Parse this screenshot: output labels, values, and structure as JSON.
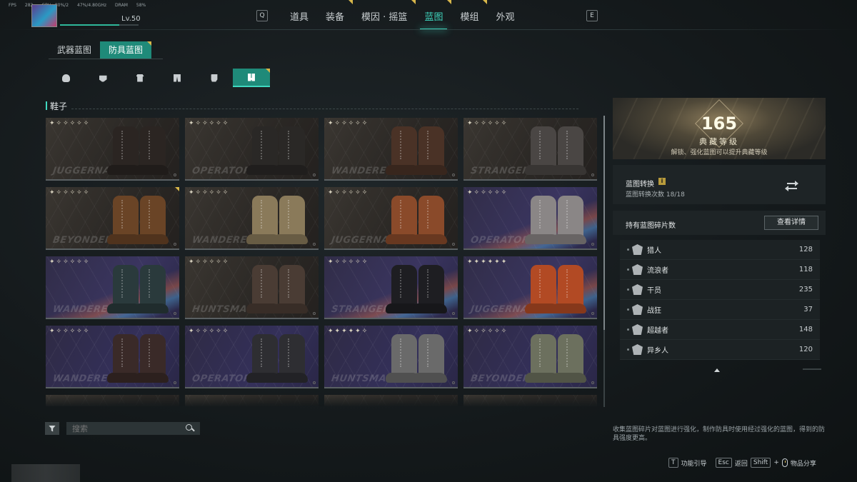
{
  "hud": {
    "fps_label": "FPS",
    "fps_value": "282",
    "gpu": "GPU : 80%/2",
    "cpu": "47%/4.80GHz",
    "dram_label": "DRAM",
    "dram_value": "58%"
  },
  "player": {
    "level": "Lv.50",
    "xp_fraction": 0.75
  },
  "top_nav": {
    "left_key": "Q",
    "right_key": "E",
    "tabs": [
      {
        "label": "道具",
        "badge": false
      },
      {
        "label": "装备",
        "badge": true
      },
      {
        "label": "模因 · 摇篮",
        "badge": true
      },
      {
        "label": "蓝图",
        "badge": true,
        "active": true
      },
      {
        "label": "模组",
        "badge": true
      },
      {
        "label": "外观",
        "badge": false
      }
    ]
  },
  "blueprint_tabs": [
    {
      "label": "武器蓝图",
      "active": false
    },
    {
      "label": "防具蓝图",
      "active": true,
      "badge": true
    }
  ],
  "armor_slots": [
    {
      "icon": "helmet-icon"
    },
    {
      "icon": "mask-icon"
    },
    {
      "icon": "top-icon"
    },
    {
      "icon": "pants-icon"
    },
    {
      "icon": "gloves-icon"
    },
    {
      "icon": "boots-icon",
      "active": true,
      "badge": true
    }
  ],
  "section_title": "鞋子",
  "items": [
    {
      "brand": "JUGGERNAUT",
      "stars": "✦✧✧✧✧✧",
      "quality": "common",
      "color": "#2b2522"
    },
    {
      "brand": "OPERATOR",
      "stars": "✦✧✧✧✧✧",
      "quality": "common",
      "color": "#2a2826"
    },
    {
      "brand": "WANDERER",
      "stars": "✦✧✧✧✧✧",
      "quality": "common",
      "color": "#4a3226"
    },
    {
      "brand": "STRANGER",
      "stars": "✦✧✧✧✧✧",
      "quality": "common",
      "color": "#4a4644"
    },
    {
      "brand": "BEYONDER",
      "stars": "✦✧✧✧✧✧",
      "quality": "common",
      "color": "#6a4426",
      "badge": true
    },
    {
      "brand": "WANDERER",
      "stars": "✦✧✧✧✧✧",
      "quality": "common",
      "color": "#8a7a5a"
    },
    {
      "brand": "JUGGERNAUT",
      "stars": "✦✧✧✧✧✧",
      "quality": "common",
      "color": "#8a4a2a"
    },
    {
      "brand": "OPERATOR",
      "stars": "✦✧✧✧✧✧",
      "quality": "rainbow",
      "color": "#8a8686"
    },
    {
      "brand": "WANDERER",
      "stars": "✦✧✧✧✧✧",
      "quality": "rainbow",
      "color": "#2a3a3c"
    },
    {
      "brand": "HUNTSMAN",
      "stars": "✦✧✧✧✧✧",
      "quality": "common",
      "color": "#4a3c34"
    },
    {
      "brand": "STRANGER",
      "stars": "✦✧✧✧✧✧",
      "quality": "rainbow",
      "color": "#1e1e22"
    },
    {
      "brand": "JUGGERNAUT",
      "stars": "✦✦✦✦✦✦",
      "quality": "rainbow",
      "color": "#b24a24"
    },
    {
      "brand": "WANDERER",
      "stars": "✦✧✧✧✧✧",
      "quality": "purple",
      "color": "#3a2a28"
    },
    {
      "brand": "OPERATOR",
      "stars": "✦✧✧✧✧✧",
      "quality": "purple",
      "color": "#2e2e32"
    },
    {
      "brand": "HUNTSMAN",
      "stars": "✦✦✦✦✦✧",
      "quality": "purple",
      "color": "#6a6a6a"
    },
    {
      "brand": "BEYONDER",
      "stars": "✦✧✧✧✧✧",
      "quality": "purple",
      "color": "#6c705e"
    },
    {
      "brand": "",
      "stars": "",
      "quality": "common",
      "color": "#2a2826"
    },
    {
      "brand": "",
      "stars": "",
      "quality": "common",
      "color": "#2a2826"
    },
    {
      "brand": "",
      "stars": "",
      "quality": "common",
      "color": "#2a2826"
    },
    {
      "brand": "",
      "stars": "",
      "quality": "common",
      "color": "#2a2826"
    }
  ],
  "search": {
    "placeholder": "搜索"
  },
  "collection": {
    "level": "165",
    "label": "典藏等级",
    "hint": "解锁、强化蓝图可以提升典藏等级"
  },
  "conversion": {
    "title": "蓝图转换",
    "info_icon": "i",
    "count_label": "蓝图转换次数 18/18"
  },
  "fragments": {
    "title": "持有蓝图碎片数",
    "detail_button": "查看详情",
    "rows": [
      {
        "name": "猎人",
        "count": "128",
        "icon": "hunter-emblem-icon"
      },
      {
        "name": "流浪者",
        "count": "118",
        "icon": "wanderer-emblem-icon"
      },
      {
        "name": "干员",
        "count": "235",
        "icon": "operator-emblem-icon"
      },
      {
        "name": "战狂",
        "count": "37",
        "icon": "juggernaut-emblem-icon"
      },
      {
        "name": "超越者",
        "count": "148",
        "icon": "beyonder-emblem-icon"
      },
      {
        "name": "异乡人",
        "count": "120",
        "icon": "stranger-emblem-icon"
      }
    ]
  },
  "description": "收集蓝图碎片对蓝图进行强化，制作防具时使用经过强化的蓝图，得到的防具强度更高。",
  "hints": {
    "guide_key": "T",
    "guide_label": "功能引导",
    "back_key": "Esc",
    "back_label": "返回",
    "share_key": "Shift",
    "plus": "+",
    "share_label": "物品分享"
  },
  "colors": {
    "accent": "#3fd8c0",
    "active_tab_bg": "#1f8a79",
    "badge": "#d8b74a"
  }
}
